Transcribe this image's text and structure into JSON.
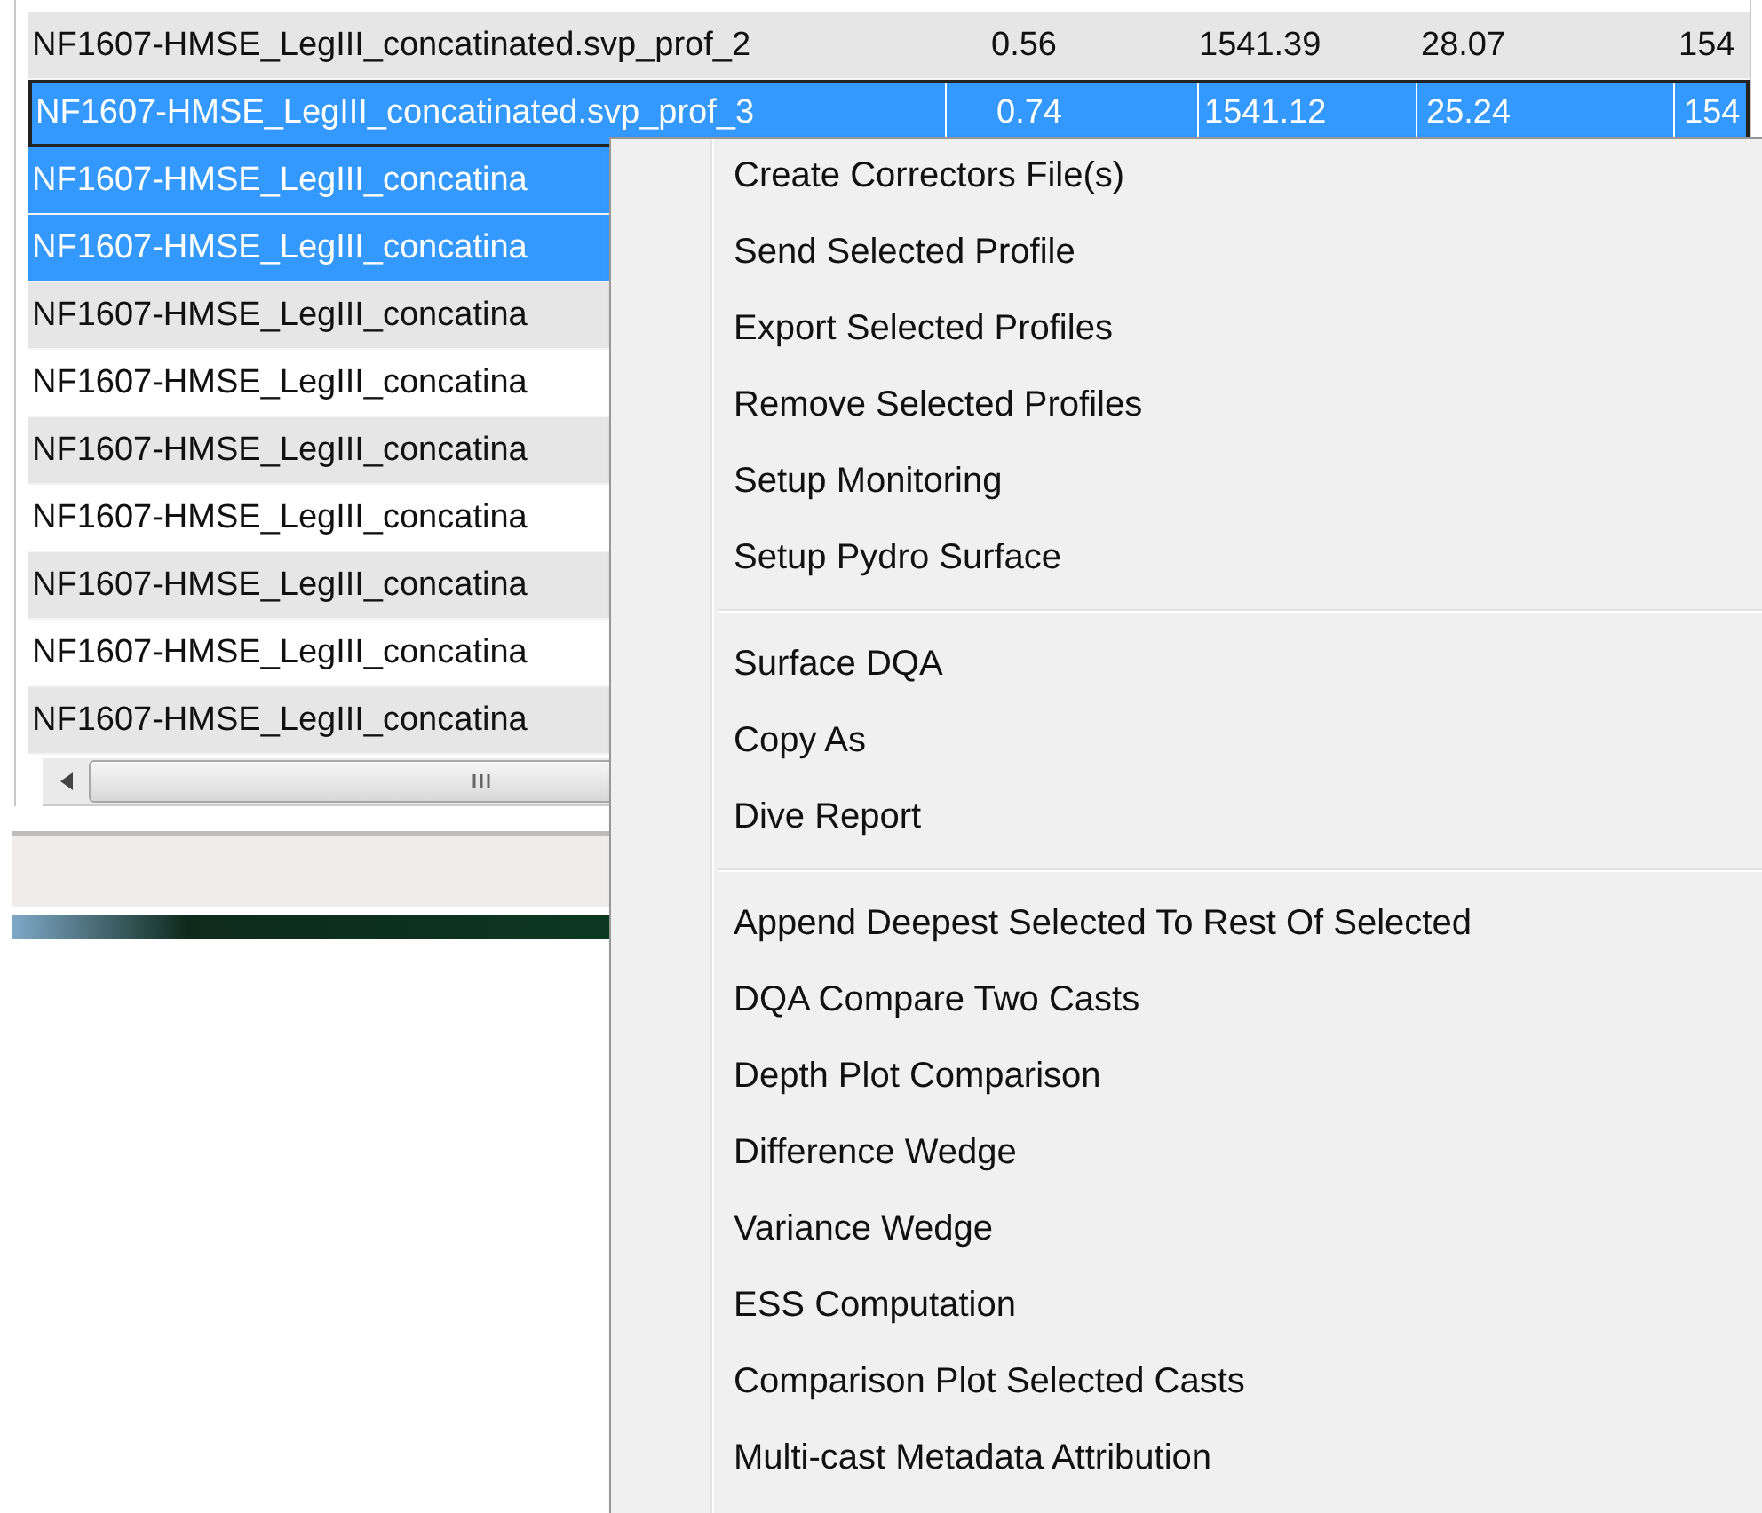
{
  "table": {
    "rows": [
      {
        "selected": false,
        "focused": false,
        "cells": [
          "NF1607-HMSE_LegIII_concatinated.svp_prof_2",
          "0.56",
          "1541.39",
          "28.07",
          "154"
        ]
      },
      {
        "selected": true,
        "focused": true,
        "cells": [
          "NF1607-HMSE_LegIII_concatinated.svp_prof_3",
          "0.74",
          "1541.12",
          "25.24",
          "154"
        ]
      },
      {
        "selected": true,
        "focused": false,
        "cells": [
          "NF1607-HMSE_LegIII_concatina"
        ]
      },
      {
        "selected": true,
        "focused": false,
        "cells": [
          "NF1607-HMSE_LegIII_concatina"
        ]
      },
      {
        "selected": false,
        "focused": false,
        "cells": [
          "NF1607-HMSE_LegIII_concatina"
        ]
      },
      {
        "selected": false,
        "focused": false,
        "cells": [
          "NF1607-HMSE_LegIII_concatina"
        ]
      },
      {
        "selected": false,
        "focused": false,
        "cells": [
          "NF1607-HMSE_LegIII_concatina"
        ]
      },
      {
        "selected": false,
        "focused": false,
        "cells": [
          "NF1607-HMSE_LegIII_concatina"
        ]
      },
      {
        "selected": false,
        "focused": false,
        "cells": [
          "NF1607-HMSE_LegIII_concatina"
        ]
      },
      {
        "selected": false,
        "focused": false,
        "cells": [
          "NF1607-HMSE_LegIII_concatina"
        ]
      },
      {
        "selected": false,
        "focused": false,
        "cells": [
          "NF1607-HMSE_LegIII_concatina"
        ]
      }
    ]
  },
  "context_menu": {
    "groups": [
      [
        "Create Correctors File(s)",
        "Send Selected Profile",
        "Export Selected Profiles",
        "Remove Selected Profiles",
        "Setup Monitoring",
        "Setup Pydro Surface"
      ],
      [
        "Surface DQA",
        "Copy As",
        "Dive Report"
      ],
      [
        "Append Deepest Selected To Rest Of Selected",
        "DQA Compare Two Casts",
        "Depth Plot Comparison",
        "Difference Wedge",
        "Variance Wedge",
        "ESS Computation",
        "Comparison Plot Selected Casts",
        "Multi-cast Metadata Attribution"
      ]
    ]
  }
}
